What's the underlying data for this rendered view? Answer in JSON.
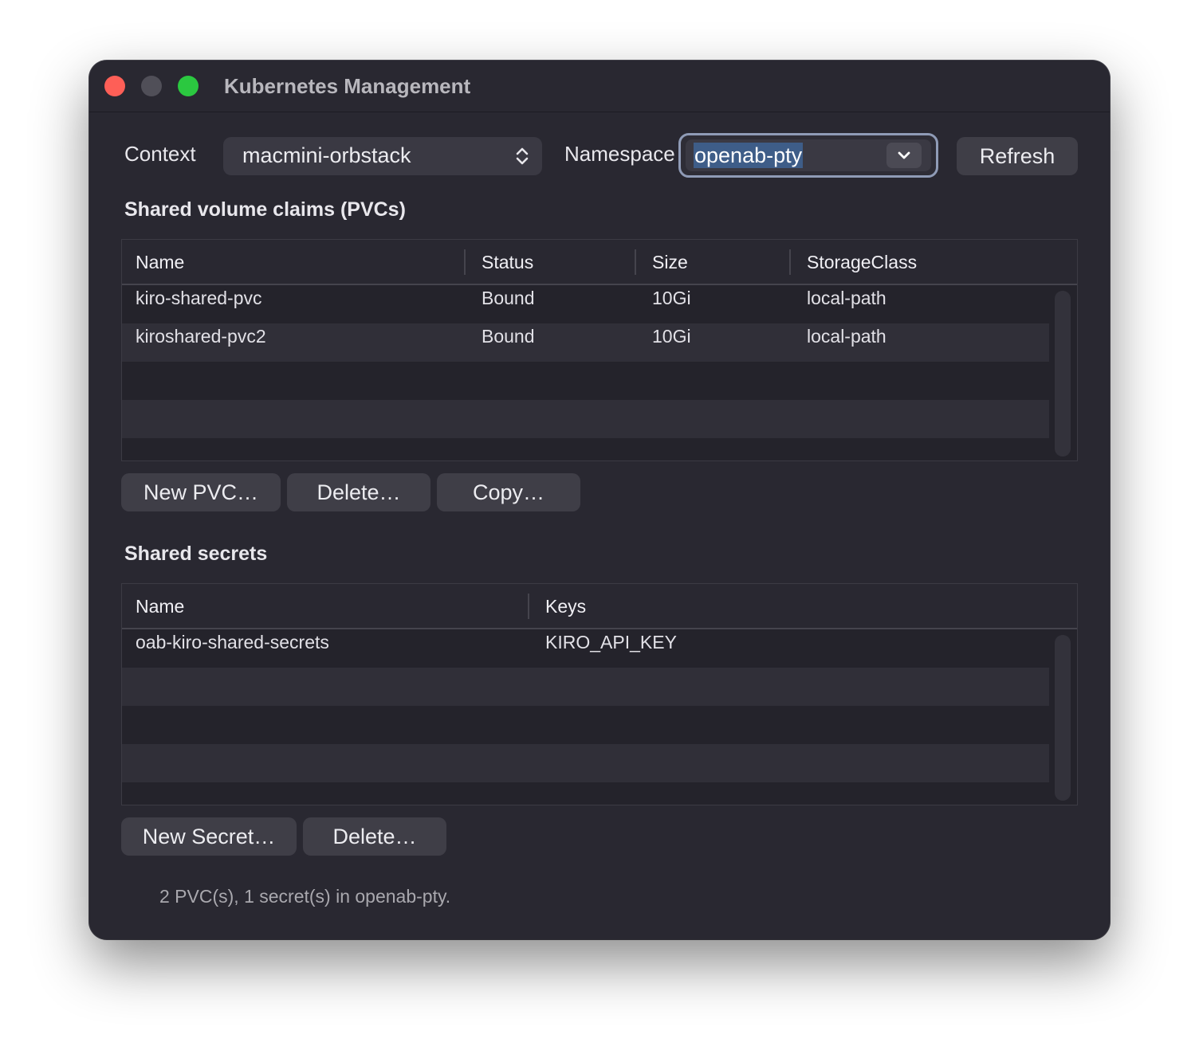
{
  "window": {
    "title": "Kubernetes Management"
  },
  "toolbar": {
    "context_label": "Context",
    "context_value": "macmini-orbstack",
    "namespace_label": "Namespace",
    "namespace_value": "openab-pty",
    "refresh_label": "Refresh"
  },
  "pvcs": {
    "title": "Shared volume claims (PVCs)",
    "columns": [
      "Name",
      "Status",
      "Size",
      "StorageClass"
    ],
    "rows": [
      [
        "kiro-shared-pvc",
        "Bound",
        "10Gi",
        "local-path"
      ],
      [
        "kiroshared-pvc2",
        "Bound",
        "10Gi",
        "local-path"
      ]
    ],
    "buttons": {
      "new": "New PVC…",
      "delete": "Delete…",
      "copy": "Copy…"
    }
  },
  "secrets": {
    "title": "Shared secrets",
    "columns": [
      "Name",
      "Keys"
    ],
    "rows": [
      [
        "oab-kiro-shared-secrets",
        "KIRO_API_KEY"
      ]
    ],
    "buttons": {
      "new": "New Secret…",
      "delete": "Delete…"
    }
  },
  "status": "2 PVC(s), 1 secret(s) in openab-pty.",
  "colors": {
    "window_bg": "#292831",
    "close": "#fe5f57",
    "maximize": "#2bc840",
    "focus_ring": "#8f9bb6",
    "selection": "#3e5d88"
  }
}
